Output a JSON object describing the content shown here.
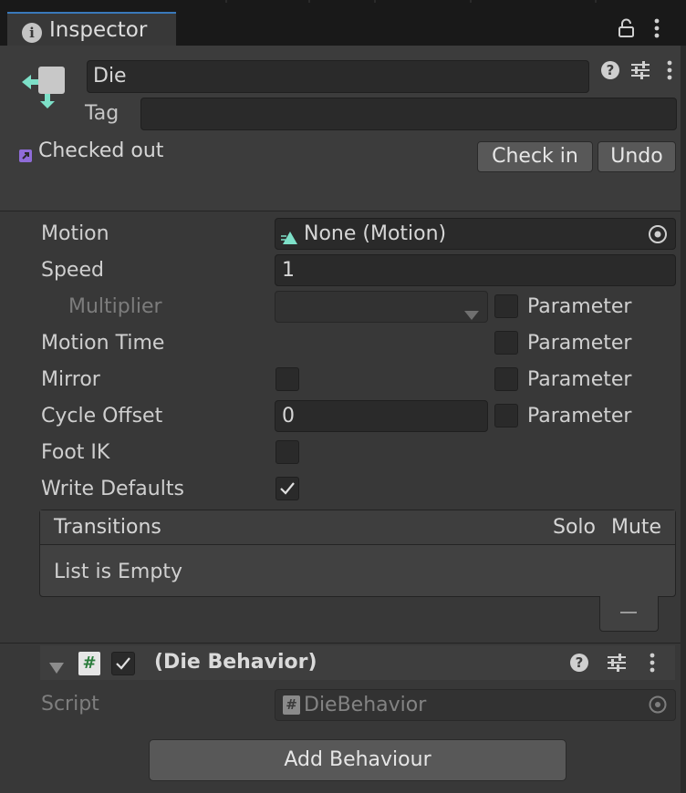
{
  "window": {
    "tab_label": "Inspector",
    "icons": {
      "tab": "info-icon",
      "lock": "lock-icon",
      "menu": "kebab-menu-icon"
    }
  },
  "header": {
    "name_value": "Die",
    "tag_label": "Tag",
    "tag_value": "",
    "vcs_status": "Checked out",
    "check_in_label": "Check in",
    "undo_label": "Undo",
    "icons": {
      "state": "animator-state-icon",
      "help": "help-icon",
      "preset": "preset-icon",
      "menu": "kebab-menu-icon"
    }
  },
  "properties": {
    "motion": {
      "label": "Motion",
      "value": "None (Motion)"
    },
    "speed": {
      "label": "Speed",
      "value": "1"
    },
    "multiplier": {
      "label": "Multiplier",
      "value": "",
      "parameter_label": "Parameter",
      "parameter_checked": false
    },
    "motion_time": {
      "label": "Motion Time",
      "parameter_label": "Parameter",
      "parameter_checked": false
    },
    "mirror": {
      "label": "Mirror",
      "checked": false,
      "parameter_label": "Parameter",
      "parameter_checked": false
    },
    "cycle_offset": {
      "label": "Cycle Offset",
      "value": "0",
      "parameter_label": "Parameter",
      "parameter_checked": false
    },
    "foot_ik": {
      "label": "Foot IK",
      "checked": false
    },
    "write_defaults": {
      "label": "Write Defaults",
      "checked": true
    }
  },
  "transitions": {
    "title": "Transitions",
    "solo_label": "Solo",
    "mute_label": "Mute",
    "empty_text": "List is Empty"
  },
  "behaviour": {
    "title": "(Die Behavior)",
    "enabled": true,
    "script_label": "Script",
    "script_value": "DieBehavior",
    "script_icon_glyph": "#",
    "add_button_label": "Add Behaviour"
  },
  "colors": {
    "panel_bg": "#383838",
    "header_bg": "#3c3c3c",
    "field_bg": "#2a2a2a",
    "tab_accent": "#3a79bb",
    "state_icon_arrow": "#7de0c8",
    "vcs_icon": "#8f6cd8",
    "script_hash_green": "#2c7d3d"
  }
}
